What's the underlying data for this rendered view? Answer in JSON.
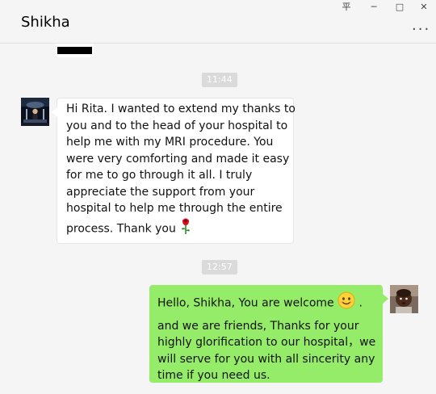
{
  "window": {
    "title": "Shikha",
    "pin_glyph": "平",
    "minimize_glyph": "─",
    "maximize_glyph": "□",
    "close_glyph": "✕",
    "more_glyph": "···"
  },
  "messages": [
    {
      "time": "11:44",
      "from": "Shikha",
      "side": "left",
      "lines": [
        "Hi Rita. I wanted to extend my thanks to",
        "you and to the head of your hospital to",
        "help me with my MRI procedure. You",
        "were very comforting and made it easy",
        "for me to go through it all. I truly",
        "appreciate the support from your",
        "hospital to help me through the entire",
        "process. Thank you"
      ],
      "trailing_icon": "rose-icon"
    },
    {
      "time": "12:57",
      "from": "Rita",
      "side": "right",
      "lines": [
        "Hello, Shikha, You are welcome",
        "and we are friends, Thanks for your",
        "highly glorification to our hospital，we",
        "will serve for you with all sincerity any",
        "time if you need us."
      ],
      "inline_icon": "smiley-icon",
      "after_icon_text": "."
    }
  ],
  "colors": {
    "sent_bubble": "#95ec69",
    "received_bubble": "#ffffff",
    "background": "#f5f5f5",
    "timestamp_bg": "#dadada"
  }
}
